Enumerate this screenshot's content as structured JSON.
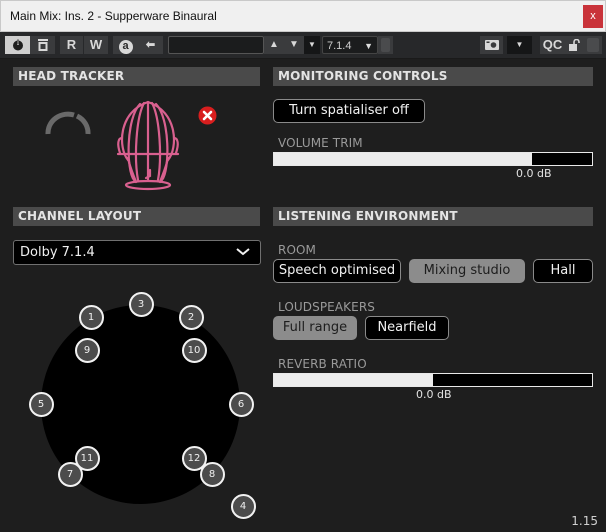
{
  "window": {
    "title": "Main Mix: Ins. 2 - Supperware Binaural",
    "close_label": "x"
  },
  "toolbar": {
    "power_icon": "power-icon",
    "bypass_icon": "bypass-icon",
    "read_label": "R",
    "write_label": "W",
    "auto_label": "a",
    "arrow_icon": "arrow-left-icon",
    "preset_value": "",
    "channel_format": "7.1.4",
    "camera_icon": "camera-icon",
    "qc_label": "QC",
    "lock_icon": "unlock-icon"
  },
  "head_tracker": {
    "header": "HEAD TRACKER",
    "status_icon": "disconnected-icon",
    "accent_color": "#d9608f",
    "status_color": "#d81e1e"
  },
  "monitoring": {
    "header": "MONITORING CONTROLS",
    "spatialiser_button": "Turn spatialiser off",
    "volume_trim_label": "VOLUME TRIM",
    "volume_trim_value": "0.0 dB",
    "volume_trim_fraction": 0.81
  },
  "channel_layout": {
    "header": "CHANNEL LAYOUT",
    "selected": "Dolby 7.1.4",
    "speakers": [
      "1",
      "2",
      "3",
      "4",
      "5",
      "6",
      "7",
      "8",
      "9",
      "10",
      "11",
      "12"
    ]
  },
  "listening": {
    "header": "LISTENING ENVIRONMENT",
    "room_label": "ROOM",
    "room_options": [
      "Speech optimised",
      "Mixing studio",
      "Hall"
    ],
    "room_selected": "Mixing studio",
    "loudspeakers_label": "LOUDSPEAKERS",
    "loudspeaker_options": [
      "Full range",
      "Nearfield"
    ],
    "loudspeaker_selected": "Full range",
    "reverb_label": "REVERB RATIO",
    "reverb_value": "0.0 dB",
    "reverb_fraction": 0.5
  },
  "version": "1.15"
}
